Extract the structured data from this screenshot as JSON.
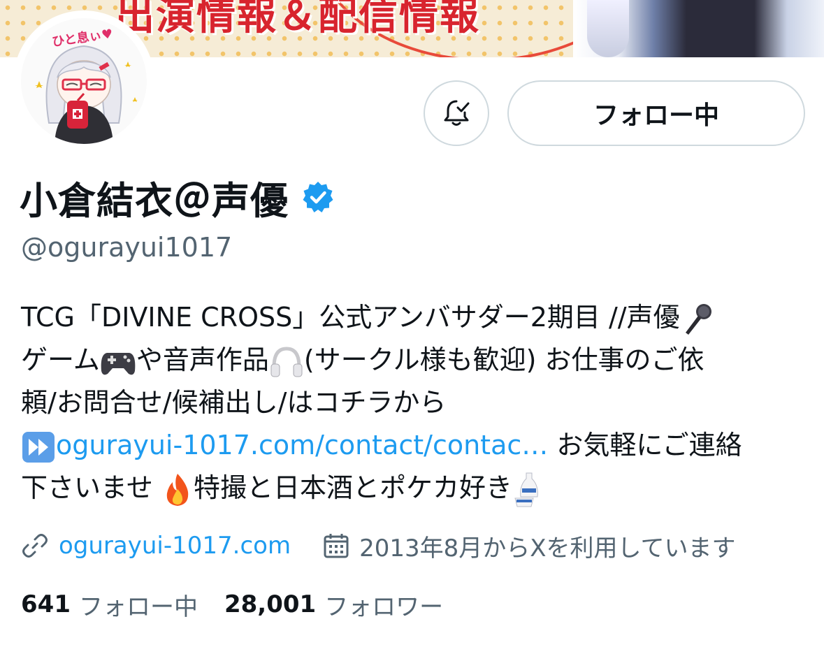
{
  "banner": {
    "text": "出演情報＆配信情報"
  },
  "profile": {
    "display_name": "小倉結衣＠声優",
    "handle": "@ogurayui1017",
    "avatar_text": "ひと息ぃ♥"
  },
  "actions": {
    "follow_label": "フォロー中"
  },
  "bio": {
    "line1": "TCG「DIVINE CROSS」公式アンバサダー2期目 //声優",
    "line2_a": "ゲーム",
    "line2_b": "や音声作品",
    "line2_c": "(サークル様も歓迎) お仕事のご依",
    "line3": "頼/お問合せ/候補出し/はコチラから",
    "line4_link": "ogurayui-1017.com/contact/contac…",
    "line4_rest": " お気軽にご連絡",
    "line5_a": "下さいませ ",
    "line5_b": "特撮と日本酒とポケカ好き"
  },
  "meta": {
    "website": "ogurayui-1017.com",
    "joined": "2013年8月からXを利用しています"
  },
  "stats": {
    "following_count": "641",
    "following_label": "フォロー中",
    "followers_count": "28,001",
    "followers_label": "フォロワー"
  },
  "colors": {
    "link": "#1d9bf0",
    "secondary_text": "#536471",
    "border": "#cfd9de",
    "verified": "#1d9bf0"
  },
  "icons": [
    "bell-check-icon",
    "verified-badge-icon",
    "link-icon",
    "calendar-icon",
    "microphone-emoji",
    "gamepad-emoji",
    "headphones-emoji",
    "fast-forward-emoji",
    "fire-emoji",
    "sake-emoji"
  ]
}
